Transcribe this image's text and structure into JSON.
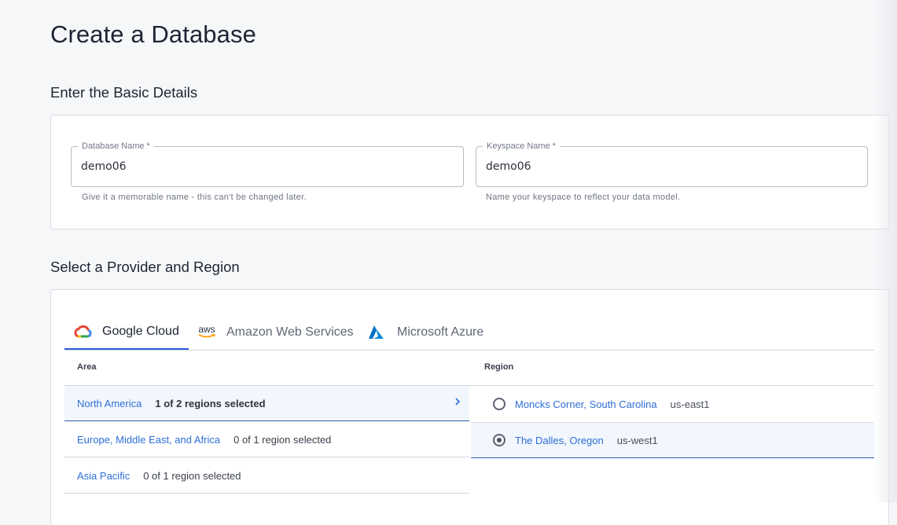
{
  "page": {
    "title": "Create a Database"
  },
  "basic": {
    "title": "Enter the Basic Details",
    "db_name": {
      "label": "Database Name *",
      "value": "demo06",
      "help": "Give it a memorable name - this can't be changed later."
    },
    "keyspace": {
      "label": "Keyspace Name *",
      "value": "demo06",
      "help": "Name your keyspace to reflect your data model."
    }
  },
  "provider": {
    "title": "Select a Provider and Region",
    "tabs": [
      {
        "label": "Google Cloud",
        "icon": "google-cloud-icon",
        "active": true
      },
      {
        "label": "Amazon Web Services",
        "icon": "aws-icon",
        "icon_text": "aws",
        "active": false
      },
      {
        "label": "Microsoft Azure",
        "icon": "azure-icon",
        "active": false
      }
    ],
    "area_header": "Area",
    "region_header": "Region",
    "areas": [
      {
        "name": "North America",
        "count": "1 of 2 regions selected",
        "selected": true
      },
      {
        "name": "Europe, Middle East, and Africa",
        "count": "0 of 1 region selected",
        "selected": false
      },
      {
        "name": "Asia Pacific",
        "count": "0 of 1 region selected",
        "selected": false
      }
    ],
    "regions": [
      {
        "name": "Moncks Corner, South Carolina",
        "code": "us-east1",
        "checked": false
      },
      {
        "name": "The Dalles, Oregon",
        "code": "us-west1",
        "checked": true
      }
    ]
  },
  "colors": {
    "accent": "#2d6fd6",
    "tab_underline": "#2b5fd9",
    "selected_bg": "#f2f6fd"
  }
}
